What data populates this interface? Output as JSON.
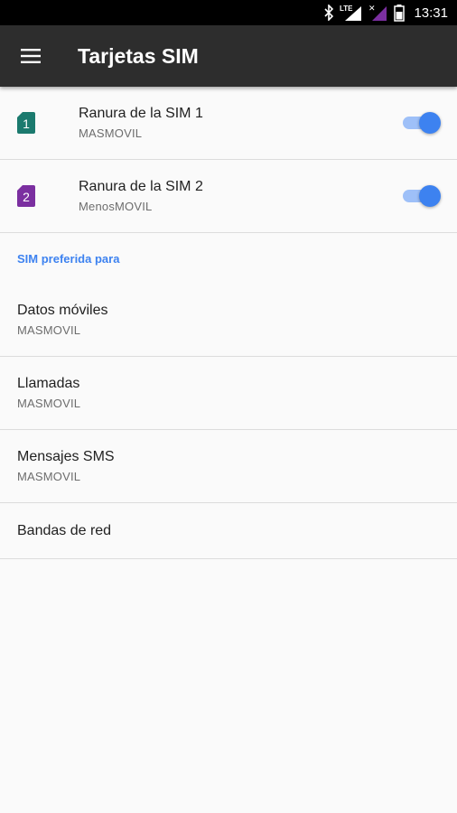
{
  "status_bar": {
    "network_type": "LTE",
    "time": "13:31"
  },
  "app_bar": {
    "title": "Tarjetas SIM",
    "menu_icon": "hamburger-menu-icon"
  },
  "sim_slots": [
    {
      "label": "Ranura de la SIM 1",
      "carrier": "MASMOVIL",
      "badge": "1",
      "badge_color": "#1b7a6e",
      "enabled": true
    },
    {
      "label": "Ranura de la SIM 2",
      "carrier": "MenosMOVIL",
      "badge": "2",
      "badge_color": "#7b2fa0",
      "enabled": true
    }
  ],
  "preferred": {
    "header": "SIM preferida para",
    "items": [
      {
        "label": "Datos móviles",
        "value": "MASMOVIL"
      },
      {
        "label": "Llamadas",
        "value": "MASMOVIL"
      },
      {
        "label": "Mensajes SMS",
        "value": "MASMOVIL"
      }
    ],
    "bands_label": "Bandas de red"
  },
  "colors": {
    "accent": "#3d82f0",
    "app_bar": "#2d2d2d",
    "background": "#fafafa"
  }
}
